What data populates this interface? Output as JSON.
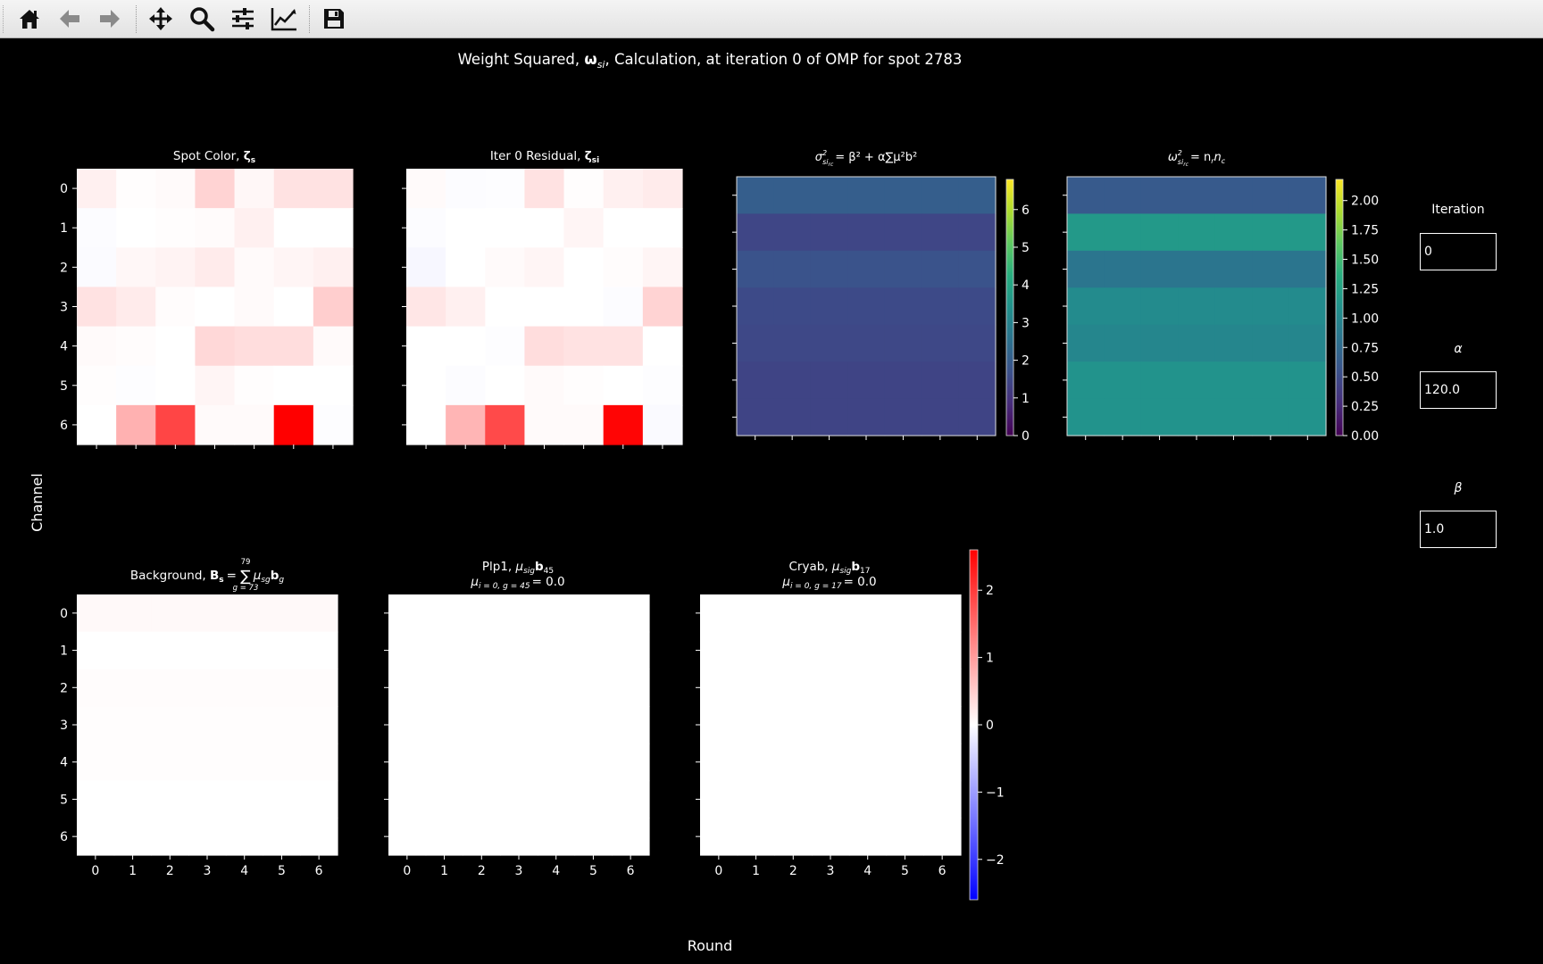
{
  "toolbar": {
    "buttons": [
      {
        "name": "home-icon",
        "tooltip": "Reset original view"
      },
      {
        "name": "back-icon",
        "tooltip": "Back to previous view"
      },
      {
        "name": "forward-icon",
        "tooltip": "Forward to next view"
      },
      {
        "name": "pan-icon",
        "tooltip": "Pan axes"
      },
      {
        "name": "zoom-icon",
        "tooltip": "Zoom to rectangle"
      },
      {
        "name": "configure-subplots-icon",
        "tooltip": "Configure subplots"
      },
      {
        "name": "edit-axis-icon",
        "tooltip": "Edit axis, curve and image parameters"
      },
      {
        "name": "save-icon",
        "tooltip": "Save the figure"
      }
    ]
  },
  "figure": {
    "suptitle": {
      "before": "Weight Squared, ",
      "symbol": "ω",
      "sub": "si",
      "after": ", Calculation, at iteration 0 of OMP for spot 2783"
    },
    "ylabel": "Channel",
    "xlabel": "Round",
    "tick_labels": [
      "0",
      "1",
      "2",
      "3",
      "4",
      "5",
      "6"
    ],
    "titles": {
      "spot_color": {
        "text": "Spot Color, ",
        "bold": "ζ",
        "bsub": "s"
      },
      "residual": {
        "text": "Iter 0 Residual, ",
        "bold": "ζ",
        "bsub": "si"
      },
      "sigma": {
        "lhs": "σ",
        "lsup": "2",
        "lsub": "si",
        "lsub2": "rc",
        "rhs": "= β² + α∑μ²b²"
      },
      "omega": {
        "lhs": "ω",
        "lsup": "2",
        "lsub": "si",
        "lsub2": "rc",
        "rhs": "= n",
        "r": "r",
        "n2": "n",
        "c": "c"
      },
      "background": {
        "text": "Background, ",
        "bold": "B",
        "bsub": "s",
        "eq": "= ",
        "sum_top": "79",
        "sum_bot": "g = 73",
        "after": "μ",
        "after_sub": "sg",
        "b": "b",
        "b_sub": "g"
      },
      "plp1": {
        "line1": "Plp1, ",
        "mu": "μ",
        "mu_sub": "sig",
        "b": "b",
        "b_sub": "45",
        "line2_mu": "μ",
        "line2_sub": "i = 0, g = 45",
        "line2_val": "= 0.0"
      },
      "cryab": {
        "line1": "Cryab, ",
        "mu": "μ",
        "mu_sub": "sig",
        "b": "b",
        "b_sub": "17",
        "line2_mu": "μ",
        "line2_sub": "i = 0, g = 17",
        "line2_val": "= 0.0"
      }
    },
    "colorbar_sigma_ticks": [
      "0",
      "1",
      "2",
      "3",
      "4",
      "5",
      "6"
    ],
    "colorbar_omega_ticks": [
      "0.00",
      "0.25",
      "0.50",
      "0.75",
      "1.00",
      "1.25",
      "1.50",
      "1.75",
      "2.00"
    ],
    "colorbar_diverging_ticks": [
      "−2",
      "−1",
      "0",
      "1",
      "2"
    ]
  },
  "widgets": {
    "iteration": {
      "label": "Iteration",
      "value": "0"
    },
    "alpha": {
      "label": "α",
      "value": "120.0"
    },
    "beta": {
      "label": "β",
      "value": "1.0"
    }
  },
  "chart_data": [
    {
      "type": "heatmap",
      "title": "Spot Color, ζs",
      "xlabel": "Round",
      "ylabel": "Channel",
      "x": [
        0,
        1,
        2,
        3,
        4,
        5,
        6
      ],
      "y": [
        0,
        1,
        2,
        3,
        4,
        5,
        6
      ],
      "colormap": "bwr",
      "vmin": -2.6,
      "vmax": 2.6,
      "values": [
        [
          0.15,
          0.02,
          0.05,
          0.45,
          0.08,
          0.3,
          0.3
        ],
        [
          -0.03,
          0.0,
          0.02,
          0.04,
          0.15,
          0.0,
          0.0
        ],
        [
          -0.04,
          0.08,
          0.12,
          0.2,
          0.05,
          0.1,
          0.15
        ],
        [
          0.3,
          0.2,
          0.03,
          0.0,
          0.05,
          0.0,
          0.5
        ],
        [
          0.05,
          0.03,
          0.0,
          0.4,
          0.35,
          0.35,
          0.05
        ],
        [
          0.02,
          -0.02,
          0.0,
          0.1,
          0.02,
          0.0,
          0.0
        ],
        [
          0.0,
          0.8,
          1.9,
          0.05,
          0.05,
          2.6,
          -0.02
        ]
      ]
    },
    {
      "type": "heatmap",
      "title": "Iter 0 Residual, ζsi",
      "colormap": "bwr",
      "vmin": -2.6,
      "vmax": 2.6,
      "values": [
        [
          0.05,
          -0.03,
          -0.02,
          0.3,
          0.02,
          0.15,
          0.2
        ],
        [
          -0.03,
          0.0,
          0.0,
          0.0,
          0.1,
          0.0,
          0.0
        ],
        [
          -0.08,
          0.0,
          0.05,
          0.1,
          0.0,
          0.03,
          0.1
        ],
        [
          0.25,
          0.15,
          0.0,
          0.0,
          0.0,
          -0.03,
          0.45
        ],
        [
          0.0,
          0.0,
          -0.02,
          0.35,
          0.3,
          0.3,
          0.0
        ],
        [
          0.0,
          -0.03,
          0.0,
          0.05,
          0.02,
          0.0,
          -0.02
        ],
        [
          0.0,
          0.75,
          1.85,
          0.05,
          0.05,
          2.55,
          -0.05
        ]
      ]
    },
    {
      "type": "heatmap",
      "title": "σ²si_rc = β² + α∑μ²sig b²grc",
      "colormap": "viridis",
      "vmin": 0,
      "vmax": 6.8,
      "row_values": [
        2.05,
        1.45,
        1.75,
        1.55,
        1.5,
        1.4,
        1.4
      ],
      "colorbar_ticks": [
        0,
        1,
        2,
        3,
        4,
        5,
        6
      ]
    },
    {
      "type": "heatmap",
      "title": "ω²si_rc",
      "colormap": "viridis",
      "vmin": 0,
      "vmax": 2.18,
      "row_values": [
        0.62,
        1.17,
        0.85,
        1.05,
        1.0,
        1.12,
        1.12
      ],
      "colorbar_ticks": [
        0.0,
        0.25,
        0.5,
        0.75,
        1.0,
        1.25,
        1.5,
        1.75,
        2.0
      ]
    },
    {
      "type": "heatmap",
      "title": "Background, Bs = ∑(g=73..79) μsg bg",
      "colormap": "bwr",
      "vmin": -2.6,
      "vmax": 2.6,
      "row_values": [
        0.06,
        0.0,
        0.03,
        0.02,
        0.02,
        0.0,
        0.0
      ]
    },
    {
      "type": "heatmap",
      "title": "Plp1, μsig b45 ; μi=0,g=45 = 0.0",
      "colormap": "bwr",
      "vmin": -2.6,
      "vmax": 2.6,
      "row_values": [
        0,
        0,
        0,
        0,
        0,
        0,
        0
      ]
    },
    {
      "type": "heatmap",
      "title": "Cryab, μsig b17 ; μi=0,g=17 = 0.0",
      "colormap": "bwr",
      "vmin": -2.6,
      "vmax": 2.6,
      "row_values": [
        0,
        0,
        0,
        0,
        0,
        0,
        0
      ],
      "colorbar_ticks": [
        -2,
        -1,
        0,
        1,
        2
      ]
    }
  ]
}
